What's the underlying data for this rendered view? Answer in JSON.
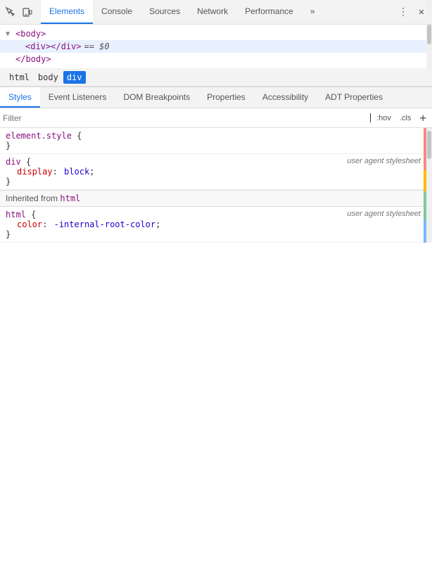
{
  "toolbar": {
    "icons": [
      "inspect-icon",
      "device-icon"
    ],
    "tabs": [
      {
        "label": "Elements",
        "active": true
      },
      {
        "label": "Console",
        "active": false
      },
      {
        "label": "Sources",
        "active": false
      },
      {
        "label": "Network",
        "active": false
      },
      {
        "label": "Performance",
        "active": false
      },
      {
        "label": "»",
        "active": false
      }
    ],
    "more_icon": "⋮",
    "close_icon": "✕"
  },
  "dom_tree": {
    "rows": [
      {
        "indent": 0,
        "arrow": "▼",
        "content_html": "<body>",
        "tag": "body",
        "selected": false
      },
      {
        "indent": 1,
        "arrow": "",
        "content": "div</div>",
        "tag": "div",
        "selected": true,
        "assigned": "== $0"
      },
      {
        "indent": 1,
        "arrow": "",
        "content": "</body>",
        "tag": "/body",
        "selected": false
      }
    ]
  },
  "breadcrumb": {
    "items": [
      {
        "label": "html",
        "active": false
      },
      {
        "label": "body",
        "active": false
      },
      {
        "label": "div",
        "active": true
      }
    ]
  },
  "panel_tabs": {
    "tabs": [
      {
        "label": "Styles",
        "active": true
      },
      {
        "label": "Event Listeners",
        "active": false
      },
      {
        "label": "DOM Breakpoints",
        "active": false
      },
      {
        "label": "Properties",
        "active": false
      },
      {
        "label": "Accessibility",
        "active": false
      },
      {
        "label": "ADT Properties",
        "active": false
      }
    ]
  },
  "filter": {
    "placeholder": "Filter",
    "hov_btn": ":hov",
    "cls_btn": ".cls",
    "plus_btn": "+"
  },
  "css_blocks": [
    {
      "id": "element_style",
      "selector": "element.style",
      "source": "",
      "properties": [],
      "open_brace": "{",
      "close_brace": "}"
    },
    {
      "id": "div_block",
      "selector": "div",
      "source": "user agent stylesheet",
      "properties": [
        {
          "prop": "display",
          "colon": ":",
          "value": "block"
        }
      ],
      "open_brace": "{",
      "close_brace": "}"
    },
    {
      "id": "inherited_from",
      "label": "Inherited from",
      "tag": "html"
    },
    {
      "id": "html_block",
      "selector": "html",
      "source": "user agent stylesheet",
      "properties": [
        {
          "prop": "color",
          "colon": ":",
          "value": "-internal-root-color"
        }
      ],
      "open_brace": "{",
      "close_brace": "}"
    }
  ],
  "colors": {
    "active_tab": "#1a73e8",
    "toolbar_bg": "#f3f3f3",
    "selected_row": "#e8f0fe",
    "tag_color": "#881280",
    "prop_color": "#c80000",
    "value_color": "#1c00cf",
    "sidebar_colors": [
      "#f6aea9",
      "#fbbc04",
      "#34a853",
      "#4285f4",
      "#a142f4"
    ]
  }
}
